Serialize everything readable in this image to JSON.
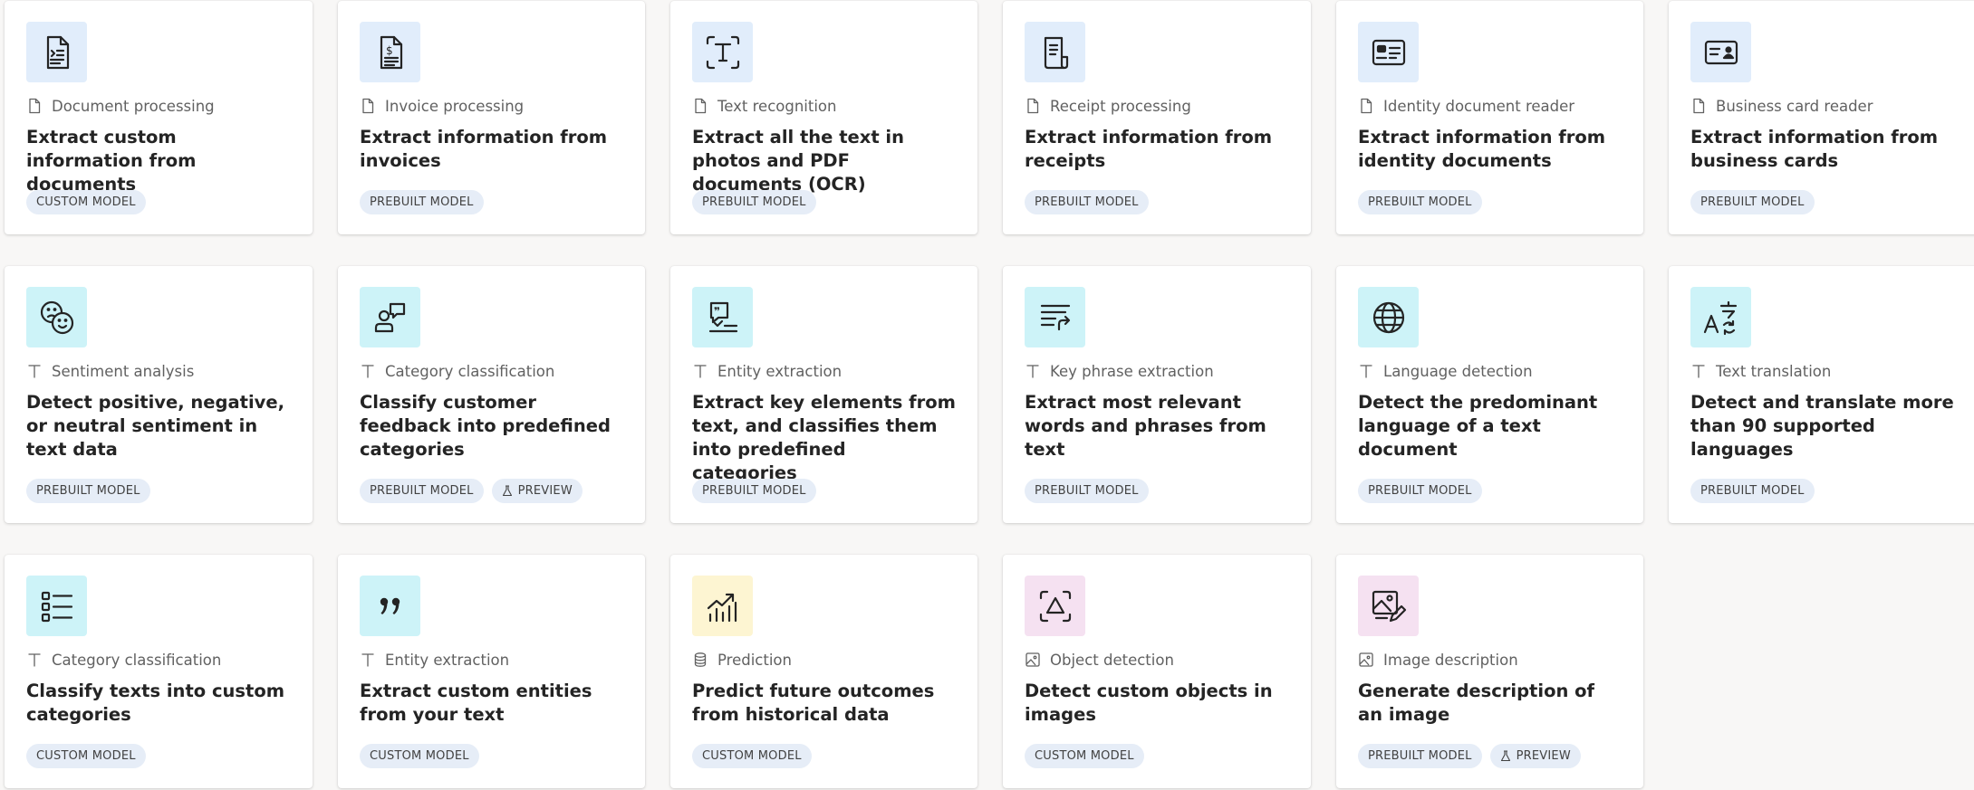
{
  "badges": {
    "custom": "CUSTOM MODEL",
    "prebuilt": "PREBUILT MODEL",
    "preview": "PREVIEW"
  },
  "cards": [
    {
      "category": "Document processing",
      "title": "Extract custom information from documents"
    },
    {
      "category": "Invoice processing",
      "title": "Extract information from invoices"
    },
    {
      "category": "Text recognition",
      "title": "Extract all the text in photos and PDF documents (OCR)"
    },
    {
      "category": "Receipt processing",
      "title": "Extract information from receipts"
    },
    {
      "category": "Identity document reader",
      "title": "Extract information from identity documents"
    },
    {
      "category": "Business card reader",
      "title": "Extract information from business cards"
    },
    {
      "category": "Sentiment analysis",
      "title": "Detect positive, negative, or neutral sentiment in text data"
    },
    {
      "category": "Category classification",
      "title": "Classify customer feedback into predefined categories"
    },
    {
      "category": "Entity extraction",
      "title": "Extract key elements from text, and classifies them into predefined categories"
    },
    {
      "category": "Key phrase extraction",
      "title": "Extract most relevant words and phrases from text"
    },
    {
      "category": "Language detection",
      "title": "Detect the predominant language of a text document"
    },
    {
      "category": "Text translation",
      "title": "Detect and translate more than 90 supported languages"
    },
    {
      "category": "Category classification",
      "title": "Classify texts into custom categories"
    },
    {
      "category": "Entity extraction",
      "title": "Extract custom entities from your text"
    },
    {
      "category": "Prediction",
      "title": "Predict future outcomes from historical data"
    },
    {
      "category": "Object detection",
      "title": "Detect custom objects in images"
    },
    {
      "category": "Image description",
      "title": "Generate description of an image"
    }
  ]
}
